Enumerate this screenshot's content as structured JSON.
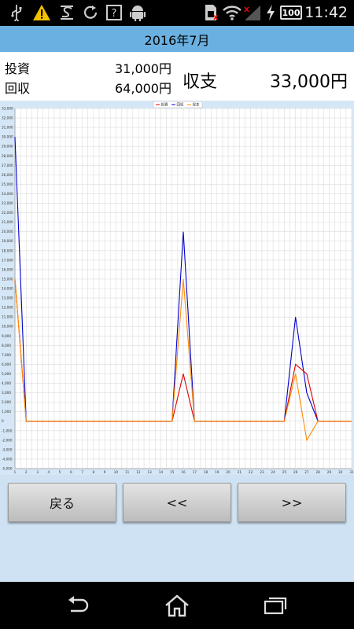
{
  "status_bar": {
    "time": "11:42",
    "battery": "100",
    "icons": [
      "usb-icon",
      "warning-icon",
      "s-icon",
      "sync-icon",
      "help-icon",
      "android-icon",
      "sim-icon",
      "wifi-icon",
      "signal-icon",
      "charging-icon",
      "battery-icon"
    ]
  },
  "header": {
    "title": "2016年7月"
  },
  "summary": {
    "investment_label": "投資",
    "investment_value": "31,000円",
    "return_label": "回収",
    "return_value": "64,000円",
    "balance_label": "収支",
    "balance_value": "33,000円"
  },
  "chart_data": {
    "type": "line",
    "x": [
      1,
      2,
      3,
      4,
      5,
      6,
      7,
      8,
      9,
      10,
      11,
      12,
      13,
      14,
      15,
      16,
      17,
      18,
      19,
      20,
      21,
      22,
      23,
      24,
      25,
      26,
      27,
      28,
      29,
      30,
      31
    ],
    "ylim": [
      -5000,
      33000
    ],
    "xlim": [
      1,
      31
    ],
    "y_ticks": [
      -5000,
      -4000,
      -3000,
      -2000,
      -1000,
      0,
      1000,
      2000,
      3000,
      4000,
      5000,
      6000,
      7000,
      8000,
      9000,
      10000,
      11000,
      12000,
      13000,
      14000,
      15000,
      16000,
      17000,
      18000,
      19000,
      20000,
      21000,
      22000,
      23000,
      24000,
      25000,
      26000,
      27000,
      28000,
      29000,
      30000,
      31000,
      32000,
      33000
    ],
    "y_tick_labels": [
      "-5,000",
      "-4,000",
      "-3,000",
      "-2,000",
      "-1,000",
      "0",
      "1,000",
      "2,000",
      "3,000",
      "4,000",
      "5,000",
      "6,000",
      "7,000",
      "8,000",
      "9,000",
      "10,000",
      "11,000",
      "12,000",
      "13,000",
      "14,000",
      "15,000",
      "16,000",
      "17,000",
      "18,000",
      "19,000",
      "20,000",
      "21,000",
      "22,000",
      "23,000",
      "24,000",
      "25,000",
      "26,000",
      "27,000",
      "28,000",
      "29,000",
      "30,000",
      "31,000",
      "32,000",
      "33,000"
    ],
    "x_tick_labels": [
      "1",
      "2",
      "3",
      "4",
      "5",
      "6",
      "7",
      "8",
      "9",
      "10",
      "11",
      "12",
      "13",
      "14",
      "15",
      "16",
      "17",
      "18",
      "19",
      "20",
      "21",
      "22",
      "23",
      "24",
      "25",
      "26",
      "27",
      "28",
      "29",
      "30",
      "31"
    ],
    "grid": true,
    "legend": "top-center",
    "series": [
      {
        "name": "投資",
        "color": "#e00000",
        "values": [
          15000,
          0,
          0,
          0,
          0,
          0,
          0,
          0,
          0,
          0,
          0,
          0,
          0,
          0,
          0,
          5000,
          0,
          0,
          0,
          0,
          0,
          0,
          0,
          0,
          0,
          6000,
          5000,
          0,
          0,
          0,
          0
        ]
      },
      {
        "name": "回収",
        "color": "#0000cc",
        "values": [
          30000,
          0,
          0,
          0,
          0,
          0,
          0,
          0,
          0,
          0,
          0,
          0,
          0,
          0,
          0,
          20000,
          0,
          0,
          0,
          0,
          0,
          0,
          0,
          0,
          0,
          11000,
          3000,
          0,
          0,
          0,
          0
        ]
      },
      {
        "name": "収支",
        "color": "#ff8c00",
        "values": [
          15000,
          0,
          0,
          0,
          0,
          0,
          0,
          0,
          0,
          0,
          0,
          0,
          0,
          0,
          0,
          15000,
          0,
          0,
          0,
          0,
          0,
          0,
          0,
          0,
          0,
          5000,
          -2000,
          0,
          0,
          0,
          0
        ]
      }
    ]
  },
  "buttons": {
    "back": "戻る",
    "prev": "<<",
    "next": ">>"
  }
}
